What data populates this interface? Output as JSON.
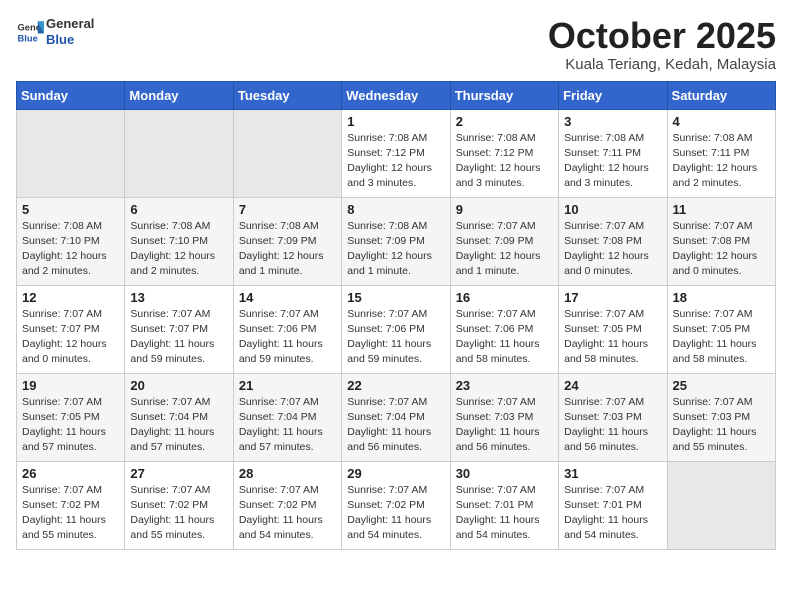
{
  "header": {
    "logo_general": "General",
    "logo_blue": "Blue",
    "month_title": "October 2025",
    "subtitle": "Kuala Teriang, Kedah, Malaysia"
  },
  "weekdays": [
    "Sunday",
    "Monday",
    "Tuesday",
    "Wednesday",
    "Thursday",
    "Friday",
    "Saturday"
  ],
  "weeks": [
    [
      {
        "day": "",
        "info": ""
      },
      {
        "day": "",
        "info": ""
      },
      {
        "day": "",
        "info": ""
      },
      {
        "day": "1",
        "info": "Sunrise: 7:08 AM\nSunset: 7:12 PM\nDaylight: 12 hours\nand 3 minutes."
      },
      {
        "day": "2",
        "info": "Sunrise: 7:08 AM\nSunset: 7:12 PM\nDaylight: 12 hours\nand 3 minutes."
      },
      {
        "day": "3",
        "info": "Sunrise: 7:08 AM\nSunset: 7:11 PM\nDaylight: 12 hours\nand 3 minutes."
      },
      {
        "day": "4",
        "info": "Sunrise: 7:08 AM\nSunset: 7:11 PM\nDaylight: 12 hours\nand 2 minutes."
      }
    ],
    [
      {
        "day": "5",
        "info": "Sunrise: 7:08 AM\nSunset: 7:10 PM\nDaylight: 12 hours\nand 2 minutes."
      },
      {
        "day": "6",
        "info": "Sunrise: 7:08 AM\nSunset: 7:10 PM\nDaylight: 12 hours\nand 2 minutes."
      },
      {
        "day": "7",
        "info": "Sunrise: 7:08 AM\nSunset: 7:09 PM\nDaylight: 12 hours\nand 1 minute."
      },
      {
        "day": "8",
        "info": "Sunrise: 7:08 AM\nSunset: 7:09 PM\nDaylight: 12 hours\nand 1 minute."
      },
      {
        "day": "9",
        "info": "Sunrise: 7:07 AM\nSunset: 7:09 PM\nDaylight: 12 hours\nand 1 minute."
      },
      {
        "day": "10",
        "info": "Sunrise: 7:07 AM\nSunset: 7:08 PM\nDaylight: 12 hours\nand 0 minutes."
      },
      {
        "day": "11",
        "info": "Sunrise: 7:07 AM\nSunset: 7:08 PM\nDaylight: 12 hours\nand 0 minutes."
      }
    ],
    [
      {
        "day": "12",
        "info": "Sunrise: 7:07 AM\nSunset: 7:07 PM\nDaylight: 12 hours\nand 0 minutes."
      },
      {
        "day": "13",
        "info": "Sunrise: 7:07 AM\nSunset: 7:07 PM\nDaylight: 11 hours\nand 59 minutes."
      },
      {
        "day": "14",
        "info": "Sunrise: 7:07 AM\nSunset: 7:06 PM\nDaylight: 11 hours\nand 59 minutes."
      },
      {
        "day": "15",
        "info": "Sunrise: 7:07 AM\nSunset: 7:06 PM\nDaylight: 11 hours\nand 59 minutes."
      },
      {
        "day": "16",
        "info": "Sunrise: 7:07 AM\nSunset: 7:06 PM\nDaylight: 11 hours\nand 58 minutes."
      },
      {
        "day": "17",
        "info": "Sunrise: 7:07 AM\nSunset: 7:05 PM\nDaylight: 11 hours\nand 58 minutes."
      },
      {
        "day": "18",
        "info": "Sunrise: 7:07 AM\nSunset: 7:05 PM\nDaylight: 11 hours\nand 58 minutes."
      }
    ],
    [
      {
        "day": "19",
        "info": "Sunrise: 7:07 AM\nSunset: 7:05 PM\nDaylight: 11 hours\nand 57 minutes."
      },
      {
        "day": "20",
        "info": "Sunrise: 7:07 AM\nSunset: 7:04 PM\nDaylight: 11 hours\nand 57 minutes."
      },
      {
        "day": "21",
        "info": "Sunrise: 7:07 AM\nSunset: 7:04 PM\nDaylight: 11 hours\nand 57 minutes."
      },
      {
        "day": "22",
        "info": "Sunrise: 7:07 AM\nSunset: 7:04 PM\nDaylight: 11 hours\nand 56 minutes."
      },
      {
        "day": "23",
        "info": "Sunrise: 7:07 AM\nSunset: 7:03 PM\nDaylight: 11 hours\nand 56 minutes."
      },
      {
        "day": "24",
        "info": "Sunrise: 7:07 AM\nSunset: 7:03 PM\nDaylight: 11 hours\nand 56 minutes."
      },
      {
        "day": "25",
        "info": "Sunrise: 7:07 AM\nSunset: 7:03 PM\nDaylight: 11 hours\nand 55 minutes."
      }
    ],
    [
      {
        "day": "26",
        "info": "Sunrise: 7:07 AM\nSunset: 7:02 PM\nDaylight: 11 hours\nand 55 minutes."
      },
      {
        "day": "27",
        "info": "Sunrise: 7:07 AM\nSunset: 7:02 PM\nDaylight: 11 hours\nand 55 minutes."
      },
      {
        "day": "28",
        "info": "Sunrise: 7:07 AM\nSunset: 7:02 PM\nDaylight: 11 hours\nand 54 minutes."
      },
      {
        "day": "29",
        "info": "Sunrise: 7:07 AM\nSunset: 7:02 PM\nDaylight: 11 hours\nand 54 minutes."
      },
      {
        "day": "30",
        "info": "Sunrise: 7:07 AM\nSunset: 7:01 PM\nDaylight: 11 hours\nand 54 minutes."
      },
      {
        "day": "31",
        "info": "Sunrise: 7:07 AM\nSunset: 7:01 PM\nDaylight: 11 hours\nand 54 minutes."
      },
      {
        "day": "",
        "info": ""
      }
    ]
  ]
}
